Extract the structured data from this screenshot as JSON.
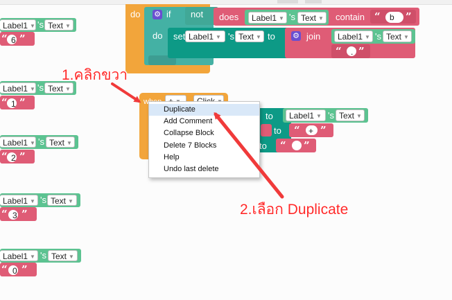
{
  "blocks": {
    "kw_do": "do",
    "kw_if": "if",
    "kw_not": "not",
    "kw_does": "does",
    "kw_contain": "contain",
    "kw_set": "set",
    "kw_to": "to",
    "kw_join": "join",
    "kw_when": "when",
    "kw_s": "'s",
    "label1": "Label1",
    "label_partial": "Label1",
    "text_prop": "Text",
    "click": "Click",
    "plus": "+",
    "str_b": "b",
    "str_dot": ".",
    "str_plus": "+",
    "str_6": "6",
    "str_1": "1",
    "str_2": "2",
    "str_3": "3",
    "str_0": "0"
  },
  "context_menu": {
    "items": [
      "Duplicate",
      "Add Comment",
      "Collapse Block",
      "Delete 7 Blocks",
      "Help",
      "Undo last delete"
    ],
    "highlighted": "Duplicate"
  },
  "annotations": {
    "step1": "1.คลิกขวา",
    "step2": "2.เลือก Duplicate",
    "color": "#ff2a2a"
  },
  "colors": {
    "event_block": "#f2a53b",
    "set_block": "#0d9a86",
    "component_block": "#5cc391",
    "text_block": "#df5c76",
    "logic_block": "#44b1a4",
    "mutator": "#6a4fd1"
  }
}
